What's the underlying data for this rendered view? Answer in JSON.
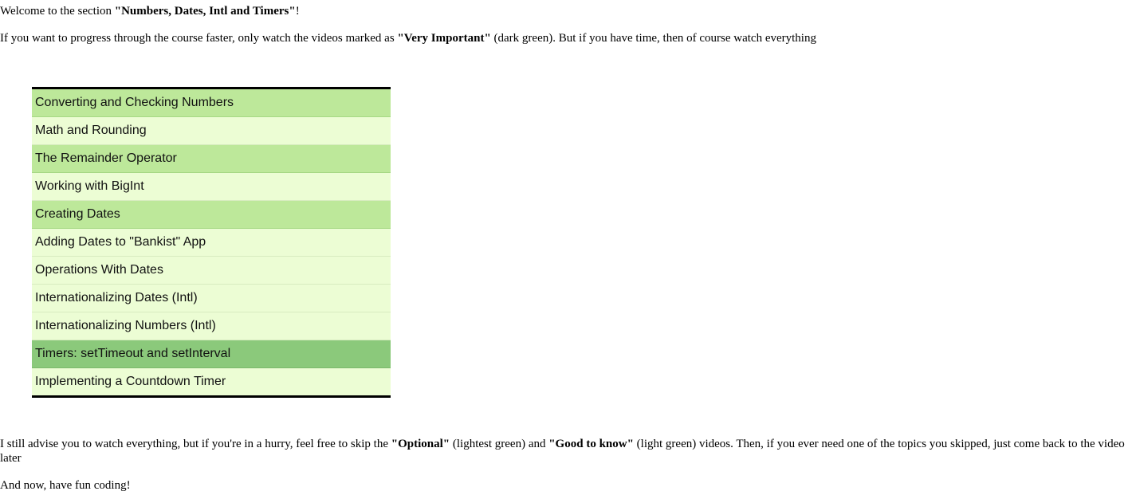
{
  "intro": {
    "welcome_prefix": "Welcome to the section ",
    "section_name": "\"Numbers, Dates, Intl and Timers\"",
    "welcome_suffix": "!",
    "progress_prefix": "If you want to progress through the course faster, only watch the videos marked as ",
    "very_important": "\"Very Important\"",
    "progress_suffix": " (dark green). But if you have time, then of course watch everything"
  },
  "lessons": [
    {
      "title": "Converting and Checking Numbers",
      "level": "good"
    },
    {
      "title": "Math and Rounding",
      "level": "optional"
    },
    {
      "title": "The Remainder Operator",
      "level": "good"
    },
    {
      "title": "Working with BigInt",
      "level": "optional"
    },
    {
      "title": "Creating Dates",
      "level": "good"
    },
    {
      "title": "Adding Dates to \"Bankist\" App",
      "level": "optional"
    },
    {
      "title": "Operations With Dates",
      "level": "optional"
    },
    {
      "title": "Internationalizing Dates (Intl)",
      "level": "optional"
    },
    {
      "title": "Internationalizing Numbers (Intl)",
      "level": "optional"
    },
    {
      "title": "Timers: setTimeout and setInterval",
      "level": "important"
    },
    {
      "title": "Implementing a Countdown Timer",
      "level": "optional"
    }
  ],
  "colors": {
    "very_important": "#8bc97b",
    "good_to_know": "#bde89a",
    "optional": "#ecfdd4"
  },
  "outro": {
    "advise_prefix": "I still advise you to watch everything, but if you're in a hurry, feel free to skip the ",
    "optional": "\"Optional\"",
    "advise_mid1": " (lightest green) and ",
    "good_to_know": "\"Good to know\"",
    "advise_suffix": " (light green) videos. Then, if you ever need one of the topics you skipped, just come back to the video later",
    "closing": "And now, have fun coding!"
  }
}
